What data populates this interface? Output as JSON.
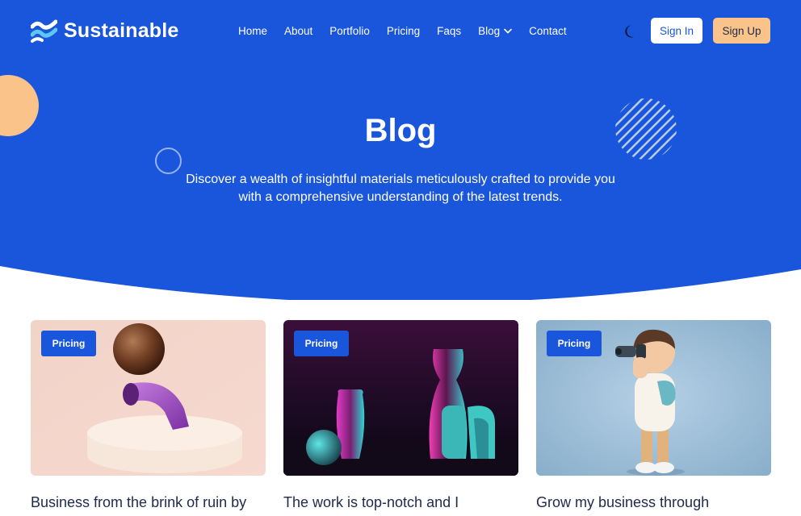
{
  "brand": {
    "name": "Sustainable",
    "logo_icon": "wave-logo-icon"
  },
  "nav": {
    "items": [
      {
        "label": "Home"
      },
      {
        "label": "About"
      },
      {
        "label": "Portfolio"
      },
      {
        "label": "Pricing"
      },
      {
        "label": "Faqs"
      },
      {
        "label": "Blog"
      },
      {
        "label": "Contact"
      }
    ],
    "dropdown_icon": "chevron-down-icon"
  },
  "header": {
    "theme_icon": "moon-icon",
    "signin_label": "Sign In",
    "signup_label": "Sign Up"
  },
  "hero": {
    "title": "Blog",
    "subtitle_line1": "Discover a wealth of insightful materials meticulously crafted to provide you",
    "subtitle_line2": "with a comprehensive understanding of the latest trends."
  },
  "colors": {
    "primary": "#1a56db",
    "accent": "#f9c38a",
    "text_dark": "#1e2a4a",
    "white": "#ffffff"
  },
  "posts": [
    {
      "tag": "Pricing",
      "title": "Business from the brink of ruin by",
      "image": "sphere-on-pipe-3d-render"
    },
    {
      "tag": "Pricing",
      "title": "The work is top-notch and I",
      "image": "neon-vases-3d-render"
    },
    {
      "tag": "Pricing",
      "title": "Grow my business through",
      "image": "boy-with-binoculars-3d-render"
    }
  ]
}
